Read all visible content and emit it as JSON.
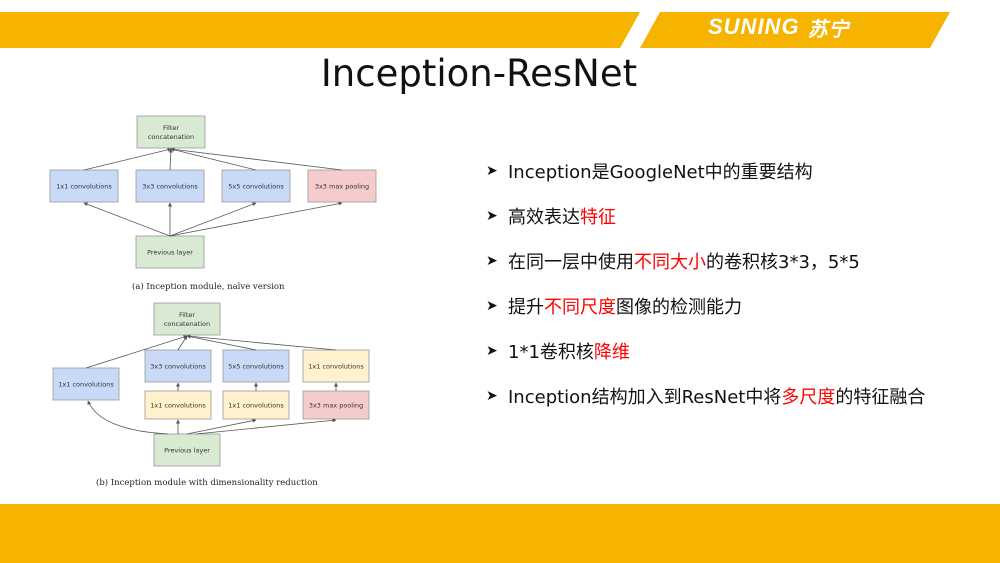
{
  "header": {
    "brand_latin": "SUNING",
    "brand_cn": "苏宁"
  },
  "title": "Inception-ResNet",
  "diagram_a": {
    "top": "Filter\nconcatenation",
    "mids": [
      "1x1 convolutions",
      "3x3 convolutions",
      "5x5 convolutions",
      "3x3 max pooling"
    ],
    "bottom": "Previous layer",
    "caption": "(a)  Inception module, naïve version"
  },
  "diagram_b": {
    "top": "Filter\nconcatenation",
    "left": "1x1 convolutions",
    "upper": [
      "3x3 convolutions",
      "5x5 convolutions",
      "1x1 convolutions"
    ],
    "lower": [
      "1x1 convolutions",
      "1x1 convolutions",
      "3x3 max pooling"
    ],
    "bottom": "Previous layer",
    "caption": "(b)  Inception module with dimensionality reduction"
  },
  "colors": {
    "blue": "#c9daf8",
    "green": "#d9ead3",
    "red": "#f4cccc",
    "yellow": "#fff2cc",
    "accent": "#f6b400",
    "highlight": "#ff0000"
  },
  "bullets": [
    {
      "icon": "arrow-bullet-icon",
      "parts": [
        {
          "t": "Inception是GoogleNet中的重要结构"
        }
      ]
    },
    {
      "icon": "arrow-bullet-icon",
      "parts": [
        {
          "t": "高效表达"
        },
        {
          "t": "特征",
          "hl": true
        }
      ]
    },
    {
      "icon": "arrow-bullet-icon",
      "parts": [
        {
          "t": "在同一层中使用"
        },
        {
          "t": "不同大小",
          "hl": true
        },
        {
          "t": "的卷积核3*3，5*5"
        }
      ]
    },
    {
      "icon": "arrow-bullet-icon",
      "parts": [
        {
          "t": "提升"
        },
        {
          "t": "不同尺度",
          "hl": true
        },
        {
          "t": "图像的检测能力"
        }
      ]
    },
    {
      "icon": "arrow-bullet-icon",
      "parts": [
        {
          "t": "1*1卷积核"
        },
        {
          "t": "降维",
          "hl": true
        }
      ]
    },
    {
      "icon": "arrow-bullet-icon",
      "parts": [
        {
          "t": "Inception结构加入到ResNet中将"
        },
        {
          "t": "多尺度",
          "hl": true
        },
        {
          "t": "的特征融合"
        }
      ]
    }
  ]
}
